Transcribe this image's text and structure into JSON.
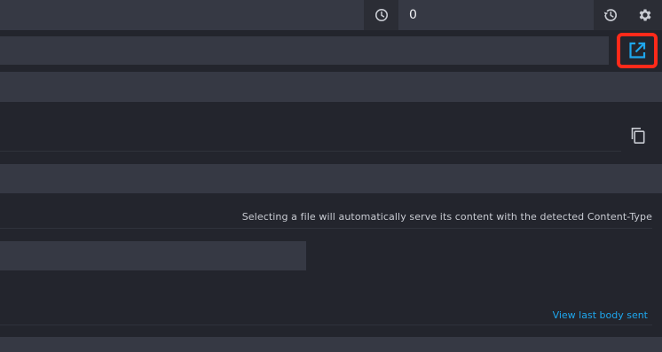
{
  "toolbar": {
    "delay_icon": "clock-icon",
    "delay_value": "0",
    "history_icon": "history-icon",
    "settings_icon": "gear-icon"
  },
  "url_row": {
    "open_icon": "open-in-new-icon",
    "highlight_color": "#ff2a1a"
  },
  "actions": {
    "copy_icon": "copy-icon"
  },
  "file_section": {
    "hint": "Selecting a file will automatically serve its content with the detected Content-Type"
  },
  "body_section": {
    "view_last_link": "View last body sent"
  },
  "colors": {
    "background": "#23252d",
    "field": "#363944",
    "accent_link": "#1ea7ee",
    "icon": "#c9ccd3"
  }
}
